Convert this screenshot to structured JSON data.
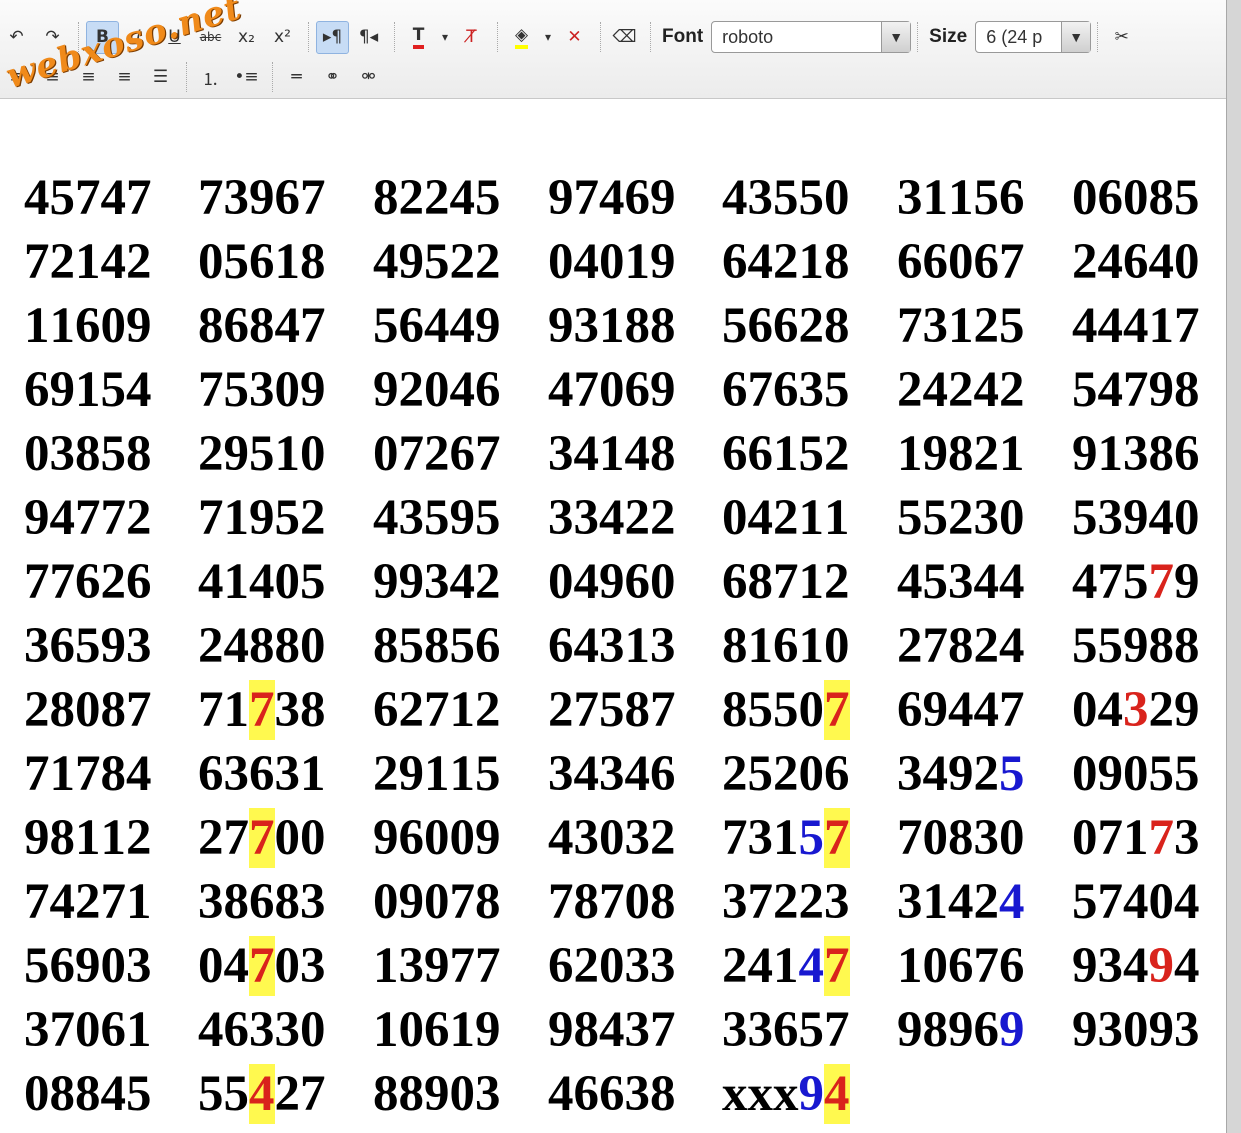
{
  "toolbar": {
    "row1": [
      {
        "name": "undo-icon",
        "glyph": "↶"
      },
      {
        "name": "redo-icon",
        "glyph": "↷"
      },
      {
        "sep": true
      },
      {
        "name": "bold-icon",
        "glyph": "B",
        "active": true
      },
      {
        "name": "italic-icon",
        "glyph": "I"
      },
      {
        "name": "underline-icon",
        "glyph": "U"
      },
      {
        "name": "strikethrough-icon",
        "glyph": "abc"
      },
      {
        "name": "subscript-icon",
        "glyph": "x₂"
      },
      {
        "name": "superscript-icon",
        "glyph": "x²"
      },
      {
        "sep": true
      },
      {
        "name": "ltr-icon",
        "glyph": "▸¶",
        "active": true
      },
      {
        "name": "rtl-icon",
        "glyph": "¶◂"
      },
      {
        "sep": true
      },
      {
        "name": "text-color-icon",
        "glyph": "T"
      },
      {
        "name": "text-color-dropdown-icon",
        "glyph": "▾"
      },
      {
        "name": "remove-text-color-icon",
        "glyph": "T̸"
      },
      {
        "sep": true
      },
      {
        "name": "highlight-color-icon",
        "glyph": "◈"
      },
      {
        "name": "highlight-dropdown-icon",
        "glyph": "▾"
      },
      {
        "name": "remove-highlight-icon",
        "glyph": "✕"
      },
      {
        "sep": true
      },
      {
        "name": "eraser-icon",
        "glyph": "⌫"
      },
      {
        "sep": true
      }
    ],
    "font_label": "Font",
    "font_value": "roboto",
    "size_label": "Size",
    "size_value": "6 (24 p",
    "row2": [
      {
        "name": "align-left-icon",
        "glyph": "≡"
      },
      {
        "name": "align-center-icon",
        "glyph": "≡"
      },
      {
        "name": "align-right-icon",
        "glyph": "≡"
      },
      {
        "name": "align-justify-icon",
        "glyph": "≡"
      },
      {
        "name": "align-full-icon",
        "glyph": "☰"
      },
      {
        "sep": true
      },
      {
        "name": "numbered-list-icon",
        "glyph": "⒈"
      },
      {
        "name": "bullet-list-icon",
        "glyph": "•≡"
      },
      {
        "sep": true
      },
      {
        "name": "horizontal-rule-icon",
        "glyph": "═"
      },
      {
        "name": "link-icon",
        "glyph": "⚭"
      },
      {
        "name": "unlink-icon",
        "glyph": "⚮"
      }
    ],
    "colors": {
      "accent": "#c7dcf5",
      "text_color_bar": "#e02020",
      "highlight_bar": "#ffff00"
    }
  },
  "watermark": "webxoso.net",
  "colors": {
    "highlight": "#fff94f",
    "red": "#d9231c",
    "blue": "#1818d0"
  },
  "grid": [
    [
      "45747",
      "73967",
      "82245",
      "97469",
      "43550",
      "31156",
      "06085"
    ],
    [
      "72142",
      "05618",
      "49522",
      "04019",
      "64218",
      "66067",
      "24640"
    ],
    [
      "11609",
      "86847",
      "56449",
      "93188",
      "56628",
      "73125",
      "44417"
    ],
    [
      "69154",
      "75309",
      "92046",
      "47069",
      "67635",
      "24242",
      "54798"
    ],
    [
      "03858",
      "29510",
      "07267",
      "34148",
      "66152",
      "19821",
      "91386"
    ],
    [
      "94772",
      "71952",
      "43595",
      "33422",
      "04211",
      "55230",
      "53940"
    ],
    [
      "77626",
      "41405",
      "99342",
      "04960",
      "68712",
      "45344",
      "47579"
    ],
    [
      "36593",
      "24880",
      "85856",
      "64313",
      "81610",
      "27824",
      "55988"
    ],
    [
      "28087",
      "71738",
      "62712",
      "27587",
      "85507",
      "69447",
      "04329"
    ],
    [
      "71784",
      "63631",
      "29115",
      "34346",
      "25206",
      "34925",
      "09055"
    ],
    [
      "98112",
      "27700",
      "96009",
      "43032",
      "73157",
      "70830",
      "07173"
    ],
    [
      "74271",
      "38683",
      "09078",
      "78708",
      "37223",
      "31424",
      "57404"
    ],
    [
      "56903",
      "04703",
      "13977",
      "62033",
      "24147",
      "10676",
      "93494"
    ],
    [
      "37061",
      "46330",
      "10619",
      "98437",
      "33657",
      "98969",
      "93093"
    ],
    [
      "08845",
      "55427",
      "88903",
      "46638",
      "xxx94"
    ]
  ],
  "marks": [
    {
      "r": 6,
      "c": 6,
      "i": 3,
      "s": "red"
    },
    {
      "r": 8,
      "c": 1,
      "i": 2,
      "s": "hlred"
    },
    {
      "r": 8,
      "c": 4,
      "i": 4,
      "s": "hlred"
    },
    {
      "r": 8,
      "c": 6,
      "i": 2,
      "s": "red"
    },
    {
      "r": 9,
      "c": 5,
      "i": 4,
      "s": "blue"
    },
    {
      "r": 10,
      "c": 1,
      "i": 2,
      "s": "hlred"
    },
    {
      "r": 10,
      "c": 4,
      "i": 3,
      "s": "blue"
    },
    {
      "r": 10,
      "c": 4,
      "i": 4,
      "s": "hlred"
    },
    {
      "r": 10,
      "c": 6,
      "i": 3,
      "s": "red"
    },
    {
      "r": 11,
      "c": 5,
      "i": 4,
      "s": "blue"
    },
    {
      "r": 12,
      "c": 1,
      "i": 2,
      "s": "hlred"
    },
    {
      "r": 12,
      "c": 4,
      "i": 3,
      "s": "blue"
    },
    {
      "r": 12,
      "c": 4,
      "i": 4,
      "s": "hlred"
    },
    {
      "r": 12,
      "c": 6,
      "i": 3,
      "s": "red"
    },
    {
      "r": 13,
      "c": 5,
      "i": 4,
      "s": "blue"
    },
    {
      "r": 14,
      "c": 1,
      "i": 2,
      "s": "hlred"
    },
    {
      "r": 14,
      "c": 4,
      "i": 3,
      "s": "blue"
    },
    {
      "r": 14,
      "c": 4,
      "i": 4,
      "s": "hlred"
    }
  ]
}
